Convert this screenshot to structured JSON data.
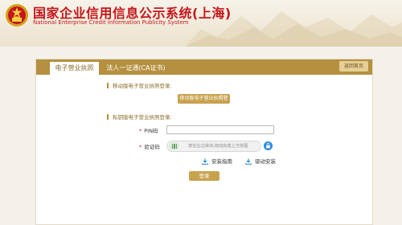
{
  "header": {
    "title_cn": "国家企业信用信息公示系统(上海)",
    "title_en": "National Enterprise Credit Information Publicity System"
  },
  "tabs": [
    {
      "label": "电子营业执照",
      "active": true
    },
    {
      "label": "法人一证通(CA证书)",
      "active": false
    }
  ],
  "back_button": "返回首页",
  "mobile_section": {
    "label": "移动版电子营业执照登录:",
    "button": "移动版电子营业执照登录"
  },
  "private_section": {
    "label": "私钥版电子营业执照登录:"
  },
  "form": {
    "pin_label": "PIN码",
    "pin_value": "",
    "captcha_label": "验证码",
    "slider_hint": "按住左边滑块,拖动完成上方拼图"
  },
  "links": {
    "install_guide": "安装指南",
    "driver_install": "驱动安装"
  },
  "login_button": "登录",
  "colors": {
    "brand_red": "#c4161c",
    "gold": "#b5903f",
    "button_gold": "#c8a24f",
    "lock_blue": "#2e8fdf"
  }
}
